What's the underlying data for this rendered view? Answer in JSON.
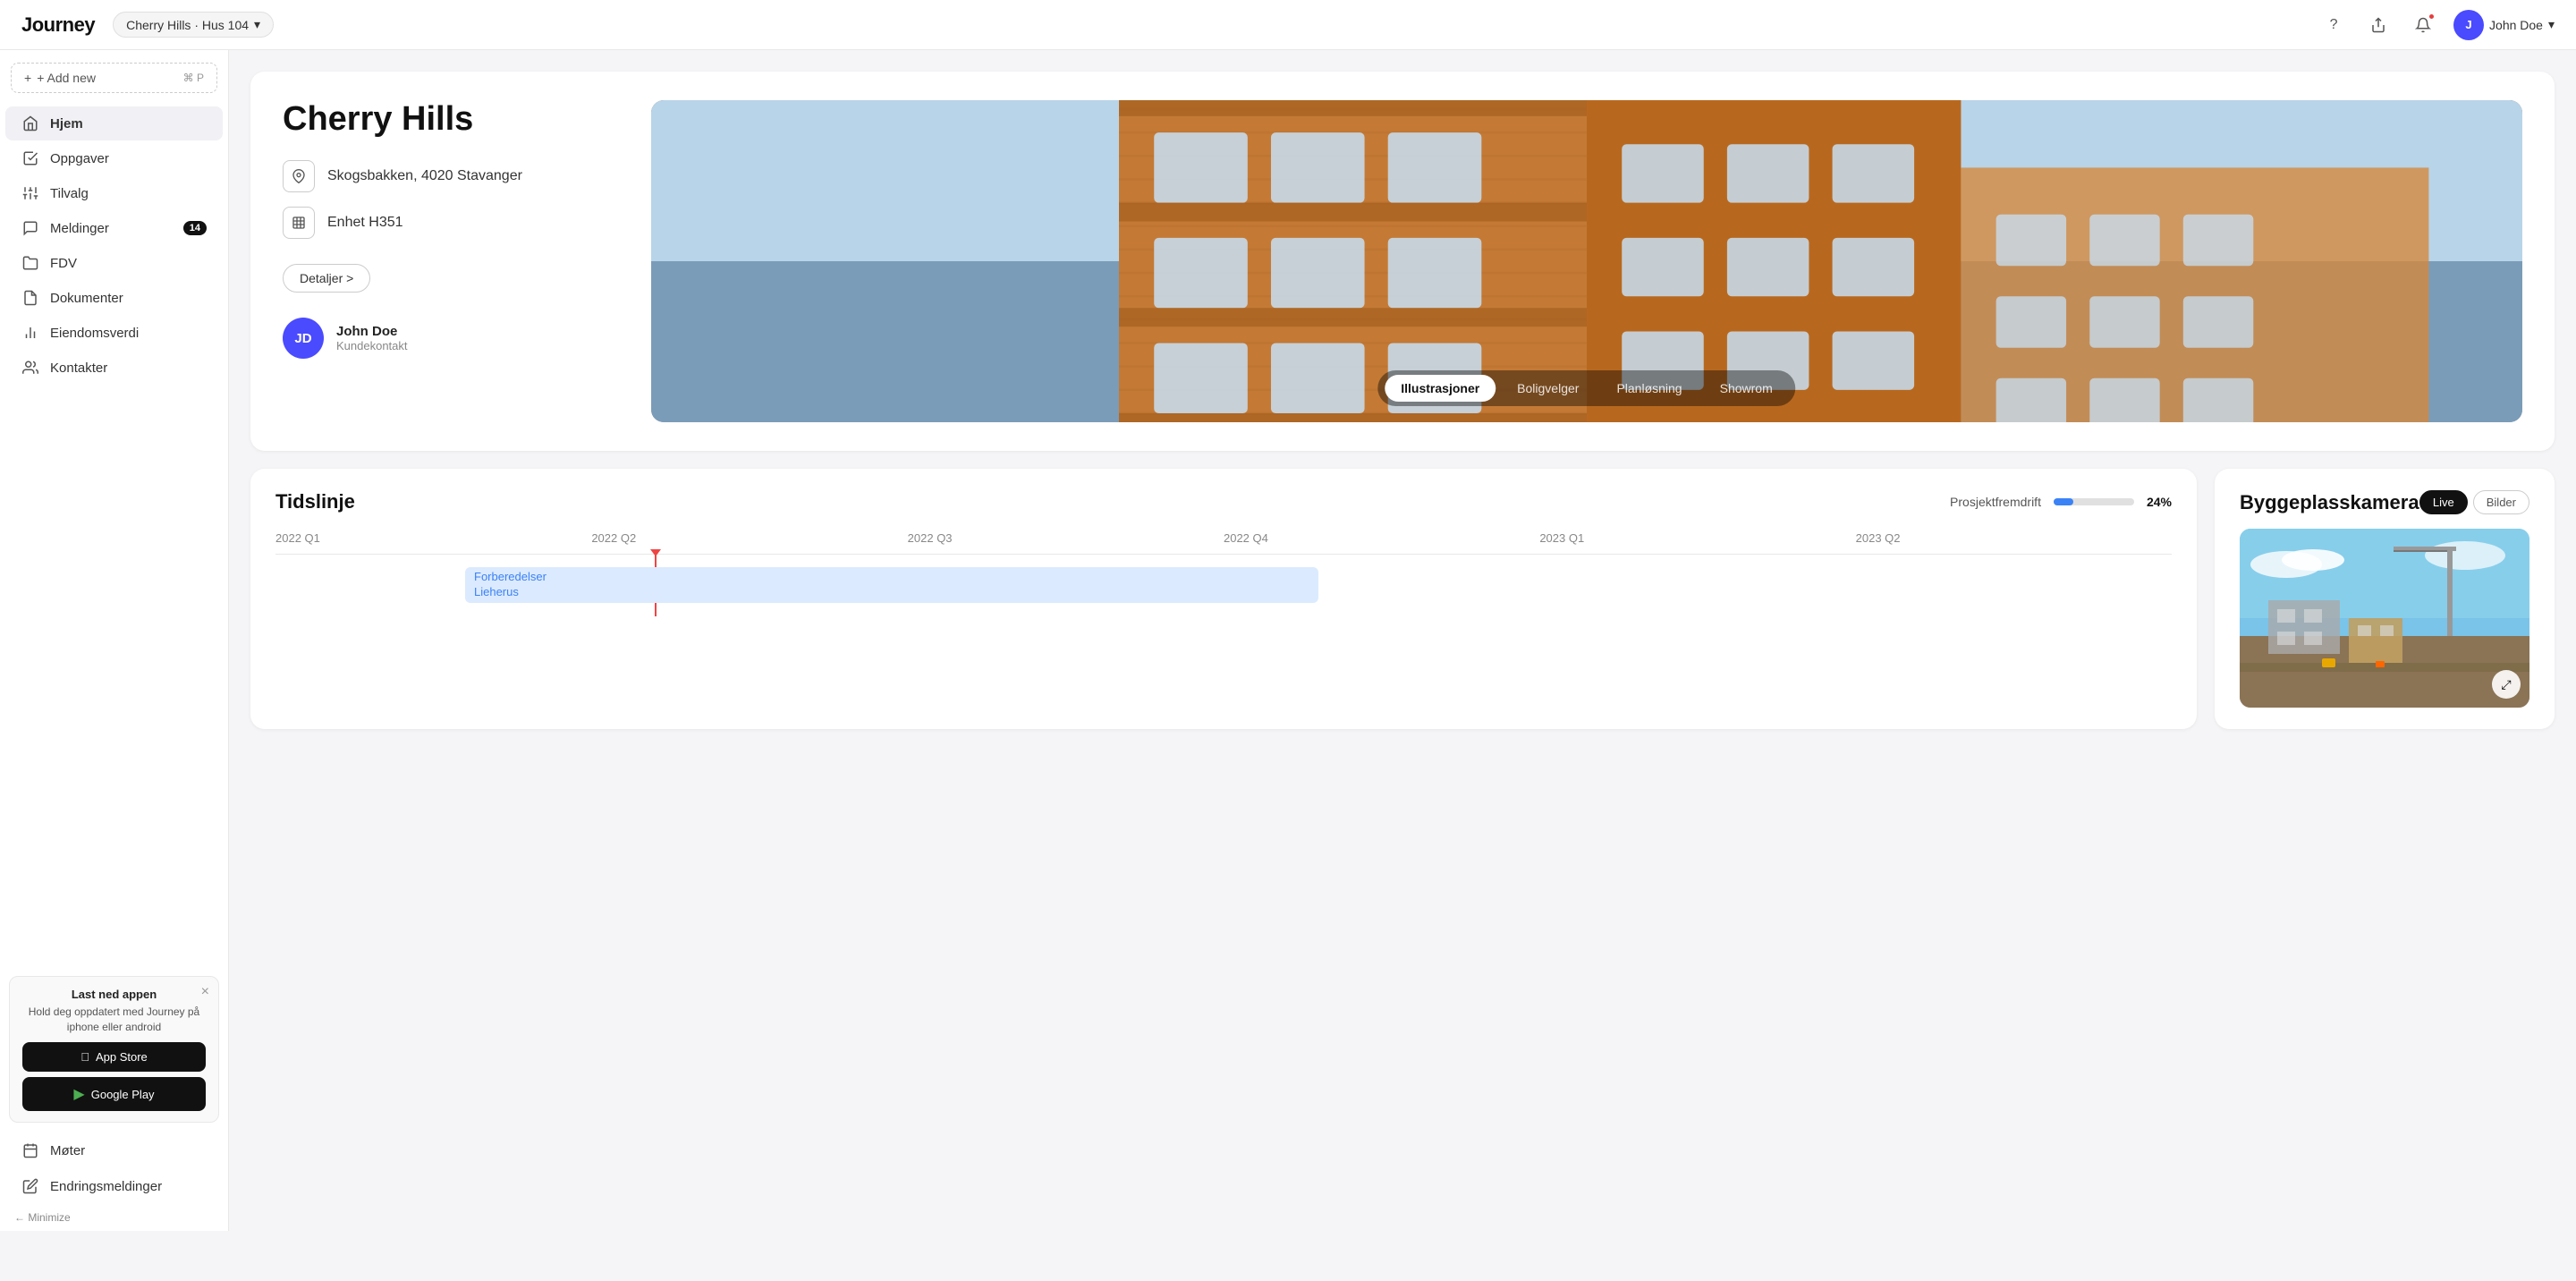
{
  "app": {
    "logo": "Journey",
    "project_selector": "Cherry Hills · Hus 104",
    "nav_question": "?",
    "nav_share": "⬆",
    "notification_has_dot": true,
    "user_initials": "J",
    "user_name": "John Doe"
  },
  "sidebar": {
    "add_btn_label": "+ Add new",
    "add_shortcut": "⌘ P",
    "items": [
      {
        "id": "hjem",
        "label": "Hjem",
        "icon": "home",
        "active": true,
        "badge": null
      },
      {
        "id": "oppgaver",
        "label": "Oppgaver",
        "icon": "check-square",
        "active": false,
        "badge": null
      },
      {
        "id": "tilvalg",
        "label": "Tilvalg",
        "icon": "sliders",
        "active": false,
        "badge": null
      },
      {
        "id": "meldinger",
        "label": "Meldinger",
        "icon": "message",
        "active": false,
        "badge": "14"
      },
      {
        "id": "fdv",
        "label": "FDV",
        "icon": "folder",
        "active": false,
        "badge": null
      },
      {
        "id": "dokumenter",
        "label": "Dokumenter",
        "icon": "file",
        "active": false,
        "badge": null
      },
      {
        "id": "eiendomsverdi",
        "label": "Eiendomsverdi",
        "icon": "bar-chart",
        "active": false,
        "badge": null
      },
      {
        "id": "kontakter",
        "label": "Kontakter",
        "icon": "users",
        "active": false,
        "badge": null
      }
    ],
    "app_banner": {
      "title": "Last ned appen",
      "body": "Hold deg oppdatert med Journey på iphone eller android",
      "appstore_label": "App Store",
      "googleplay_label": "Google Play"
    },
    "minimize_label": "← Minimize",
    "bottom_items": [
      {
        "id": "moter",
        "label": "Møter",
        "icon": "calendar"
      },
      {
        "id": "endringsmeldinger",
        "label": "Endringsmeldinger",
        "icon": "edit"
      }
    ]
  },
  "project_card": {
    "name": "Cherry Hills",
    "address": "Skogsbakken, 4020 Stavanger",
    "unit": "Enhet H351",
    "details_btn": "Detaljer >",
    "contact": {
      "initials": "JD",
      "name": "John Doe",
      "role": "Kundekontakt"
    },
    "image_tabs": [
      {
        "label": "Illustrasjoner",
        "active": true
      },
      {
        "label": "Boligvelger",
        "active": false
      },
      {
        "label": "Planløsning",
        "active": false
      },
      {
        "label": "Showrom",
        "active": false
      }
    ]
  },
  "timeline_card": {
    "title": "Tidslinje",
    "progress_label": "Prosjektfremdrift",
    "progress_pct": 24,
    "progress_pct_label": "24%",
    "quarters": [
      "2022 Q1",
      "2022 Q2",
      "2022 Q3",
      "2022 Q4",
      "2023 Q1",
      "2023 Q2"
    ],
    "bar_label_line1": "Forberedelser",
    "bar_label_line2": "Lieherus"
  },
  "camera_card": {
    "title": "Byggeplasskamera",
    "tabs": [
      {
        "label": "Live",
        "active": true
      },
      {
        "label": "Bilder",
        "active": false
      }
    ],
    "expand_icon": "⤢"
  }
}
